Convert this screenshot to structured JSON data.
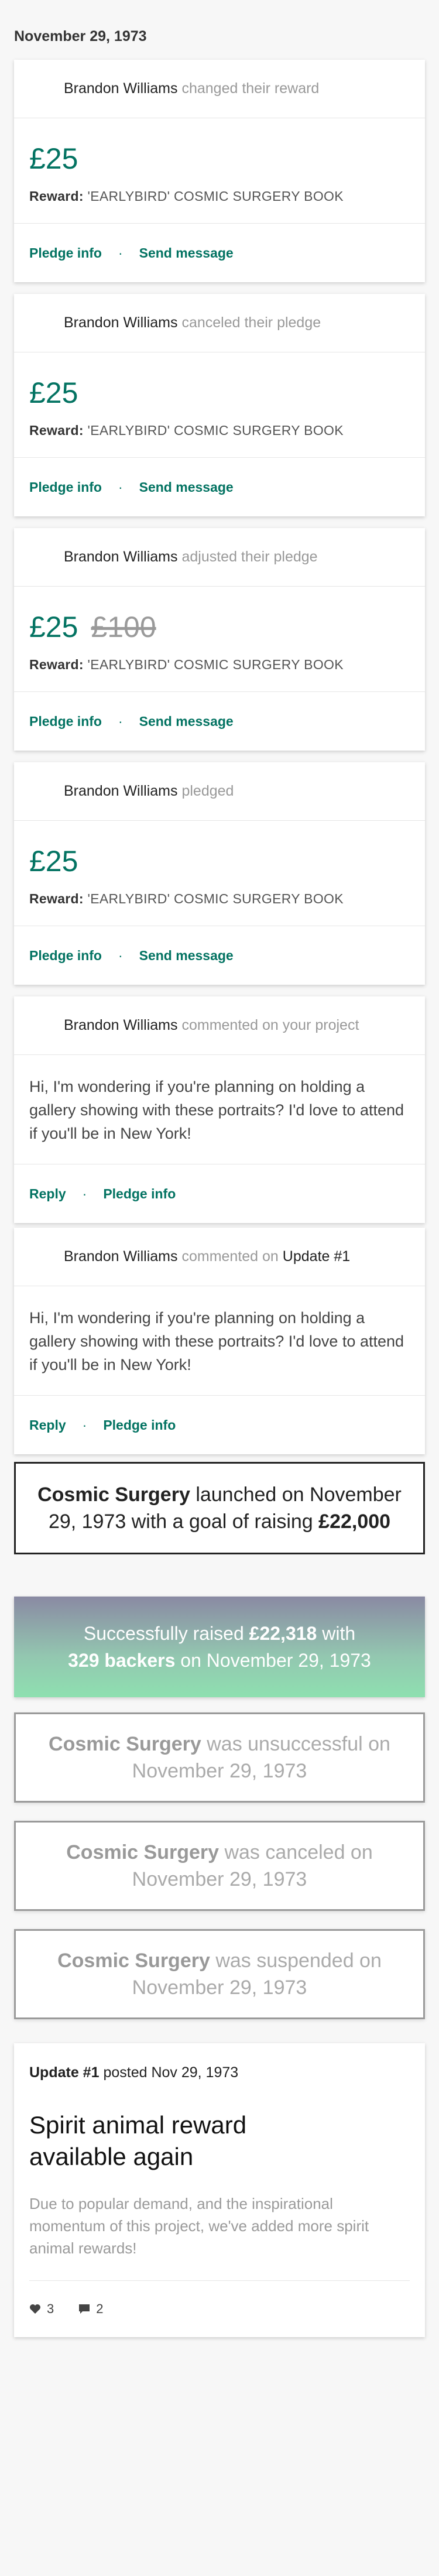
{
  "date_header": "November 29, 1973",
  "activities": [
    {
      "actor": "Brandon Williams",
      "action": "changed their reward",
      "amount": "£25",
      "reward_label": "Reward:",
      "reward": "'EARLYBIRD' COSMIC SURGERY BOOK",
      "actions": [
        "Pledge info",
        "Send message"
      ]
    },
    {
      "actor": "Brandon Williams",
      "action": "canceled their pledge",
      "amount": "£25",
      "reward_label": "Reward:",
      "reward": "'EARLYBIRD' COSMIC SURGERY BOOK",
      "actions": [
        "Pledge info",
        "Send message"
      ]
    },
    {
      "actor": "Brandon Williams",
      "action": "adjusted their pledge",
      "amount": "£25",
      "old_amount": "£100",
      "reward_label": "Reward:",
      "reward": "'EARLYBIRD' COSMIC SURGERY BOOK",
      "actions": [
        "Pledge info",
        "Send message"
      ]
    },
    {
      "actor": "Brandon Williams",
      "action": "pledged",
      "amount": "£25",
      "reward_label": "Reward:",
      "reward": "'EARLYBIRD' COSMIC SURGERY BOOK",
      "actions": [
        "Pledge info",
        "Send message"
      ]
    }
  ],
  "comments": [
    {
      "actor": "Brandon Williams",
      "action": "commented on your project",
      "target": "",
      "body": "Hi, I'm wondering if you're planning on holding a gallery showing with these portraits? I'd love to attend if you'll be in New York!",
      "actions": [
        "Reply",
        "Pledge info"
      ]
    },
    {
      "actor": "Brandon Williams",
      "action": "commented on",
      "target": "Update #1",
      "body": "Hi, I'm wondering if you're planning on holding a gallery showing with these portraits? I'd love to attend if you'll be in New York!",
      "actions": [
        "Reply",
        "Pledge info"
      ]
    }
  ],
  "launched": {
    "project": "Cosmic Surgery",
    "text1": "launched on",
    "date": "November 29, 1973",
    "text2": "with a goal of raising",
    "goal": "£22,000"
  },
  "success": {
    "text1": "Successfully raised",
    "raised": "£22,318",
    "text2": "with",
    "backers": "329 backers",
    "text3": "on November 29, 1973"
  },
  "statuses": [
    {
      "project": "Cosmic Surgery",
      "text": "was unsuccessful on November 29, 1973"
    },
    {
      "project": "Cosmic Surgery",
      "text": "was canceled on November 29, 1973"
    },
    {
      "project": "Cosmic Surgery",
      "text": "was suspended on November 29, 1973"
    }
  ],
  "update": {
    "label": "Update #1",
    "posted": "posted Nov 29, 1973",
    "title": "Spirit animal reward available again",
    "body": "Due to popular demand, and the inspirational momentum of this project, we've added more spirit animal rewards!",
    "likes": "3",
    "comments": "2"
  },
  "colors": {
    "accent": "#037362",
    "muted_text": "#999999",
    "success_gradient_top": "#8a8aa3",
    "success_gradient_bottom": "#8ee0b0"
  },
  "icons": {
    "like": "heart-icon",
    "comment": "comment-icon"
  }
}
